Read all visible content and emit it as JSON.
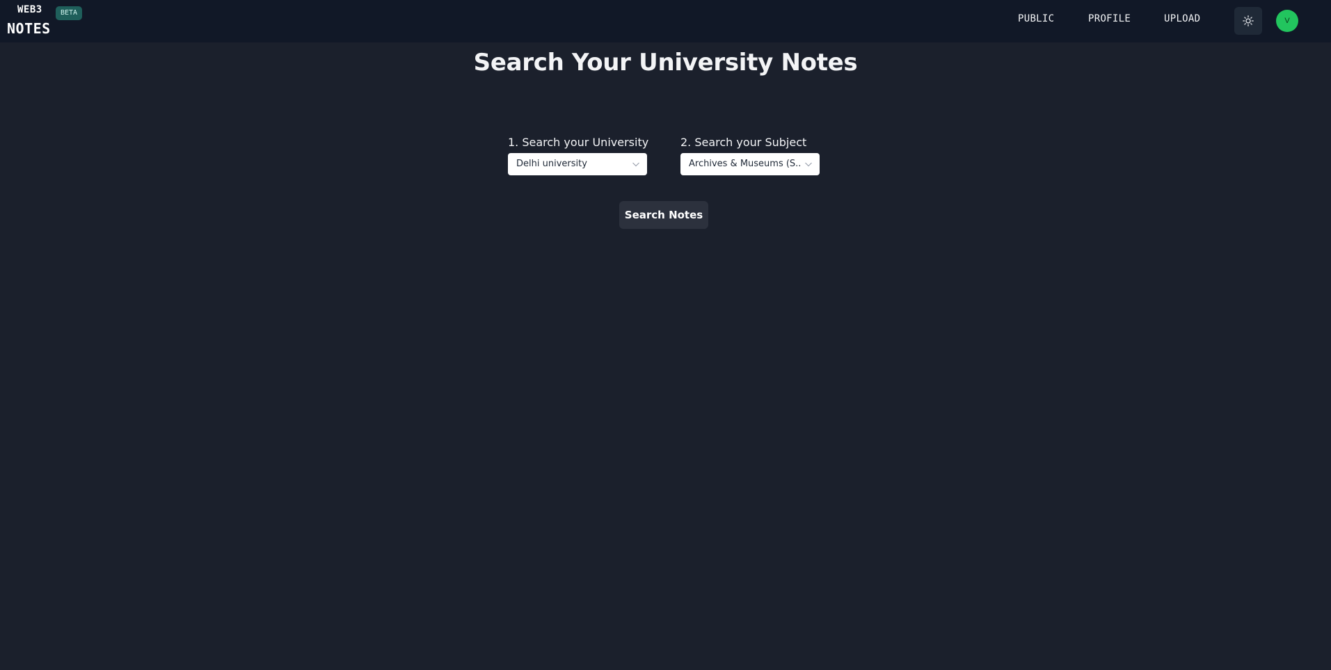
{
  "header": {
    "logo_top": "WEB3",
    "logo_bottom": "NOTES",
    "badge": "BETA",
    "nav": {
      "public": "PUBLIC",
      "profile": "PROFILE",
      "upload": "UPLOAD"
    },
    "avatar_initial": "V",
    "theme_icon": "sun-icon"
  },
  "main": {
    "title": "Search Your University Notes",
    "university": {
      "label": "1. Search your University",
      "value": "Delhi university"
    },
    "subject": {
      "label": "2. Search your Subject",
      "value": "Archives & Museums (S..."
    },
    "search_button": "Search Notes"
  },
  "colors": {
    "background": "#1b202c",
    "navbar": "#111827",
    "badge": "#1f5f5b",
    "avatar": "#22c55e",
    "button": "#2c313d"
  }
}
